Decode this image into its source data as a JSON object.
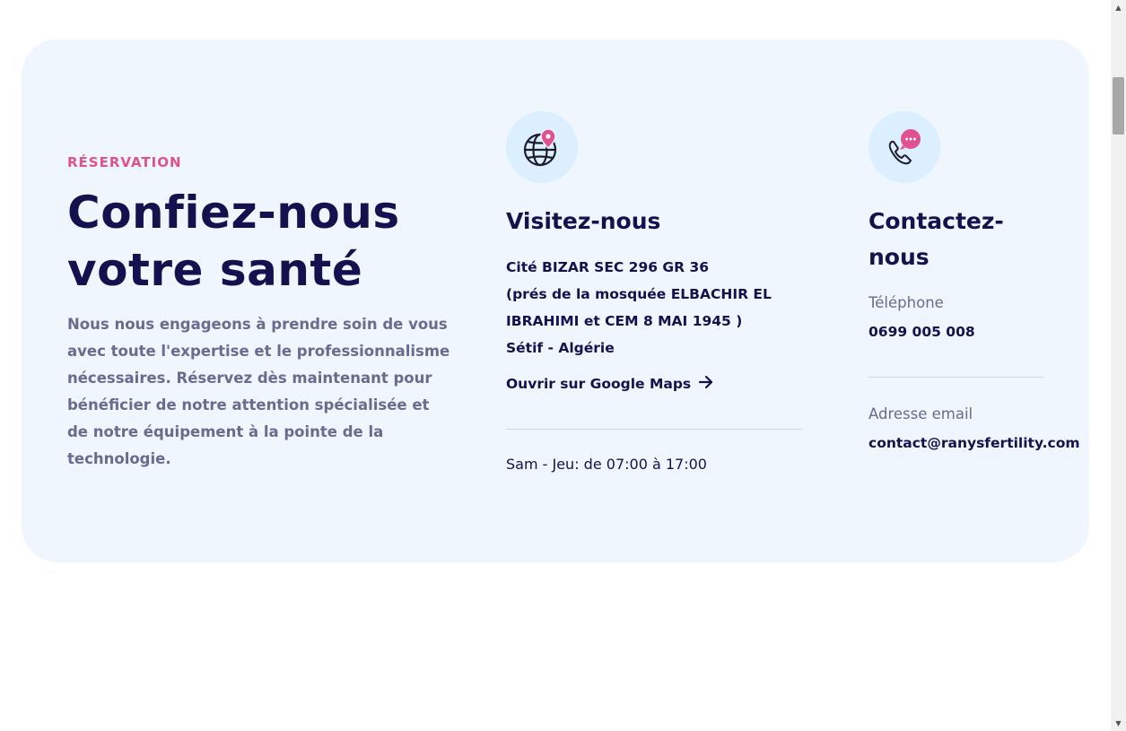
{
  "section": {
    "kicker": "RÉSERVATION",
    "headline": "Confiez-nous votre santé",
    "intro": "Nous nous engageons à prendre soin de vous avec toute l'expertise et le professionnalisme nécessaires. Réservez dès maintenant pour bénéficier de notre attention spécialisée et de notre équipement à la pointe de la technologie."
  },
  "visit": {
    "icon": "globe-location-pin-icon",
    "title": "Visitez-nous",
    "address_lines": [
      "Cité BIZAR SEC 296 GR 36",
      "(prés de la mosquée ELBACHIR EL",
      "IBRAHIMI et CEM 8 MAI 1945 )",
      "Sétif - Algérie"
    ],
    "maps_link": "Ouvrir sur Google Maps",
    "hours": "Sam - Jeu: de 07:00 à 17:00"
  },
  "contact": {
    "icon": "phone-chat-bubble-icon",
    "title": "Contactez-nous",
    "phone_label": "Téléphone",
    "phone_value": "0699 005 008",
    "email_label": "Adresse email",
    "email_value": "contact@ranysfertility.com"
  },
  "colors": {
    "accent": "#e0528f",
    "heading": "#13124f",
    "muted": "#6b6a8f",
    "card_bg": "#f0f6fd",
    "icon_bg": "#dcefff"
  }
}
